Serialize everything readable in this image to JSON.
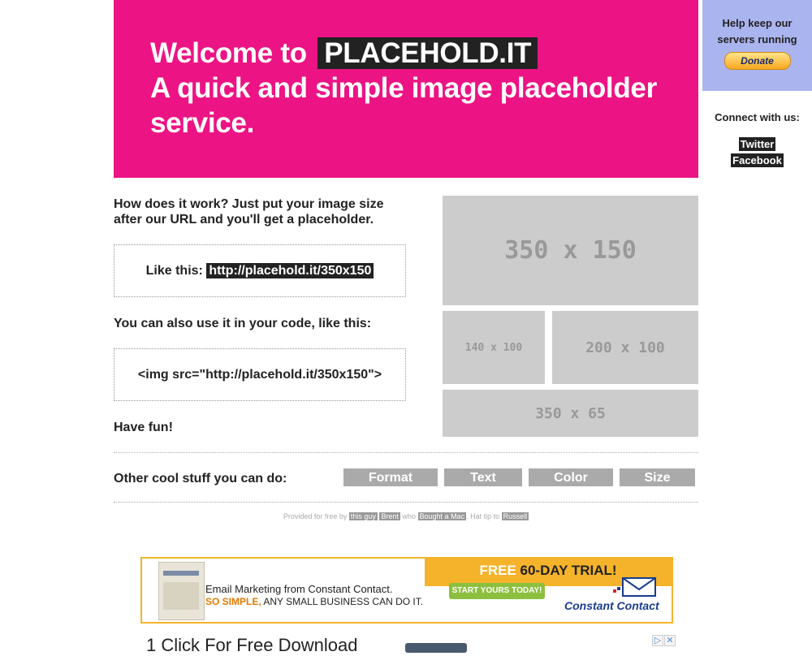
{
  "hero": {
    "welcome": "Welcome to",
    "brand": "PLACEHOLD.IT",
    "tagline_line1": "A quick and simple image placeholder",
    "tagline_line2": "service."
  },
  "sidebar": {
    "help_line1": "Help keep our",
    "help_line2": "servers running",
    "donate_label": "Donate",
    "connect_title": "Connect with us:",
    "twitter": "Twitter",
    "facebook": "Facebook"
  },
  "main": {
    "how_line1": "How does it work? Just put your image size",
    "how_line2": "after our URL and you'll get a placeholder.",
    "like_this": "Like this:",
    "example_url": "http://placehold.it/350x150",
    "code_intro": "You can also use it in your code, like this:",
    "code_sample": "<img src=\"http://placehold.it/350x150\">",
    "have_fun": "Have fun!"
  },
  "placeholders": [
    {
      "label": "350 x 150"
    },
    {
      "label": "140 x 100"
    },
    {
      "label": "200 x 100"
    },
    {
      "label": "350 x 65"
    }
  ],
  "other": {
    "title": "Other cool stuff you can do:",
    "tabs": [
      "Format",
      "Text",
      "Color",
      "Size"
    ]
  },
  "credits": {
    "provided": "Provided for free by",
    "this_guy": "this guy",
    "brent": "Brent",
    "who": "who",
    "bought_mac": "Bought a Mac",
    "hat_tip": ". Hat tip to",
    "russell": "Russell"
  },
  "ad": {
    "free": "FREE",
    "trial": "60-DAY TRIAL!",
    "line1": "Email Marketing from Constant Contact.",
    "line2_bold": "SO SIMPLE,",
    "line2_rest": "ANY SMALL BUSINESS CAN DO IT.",
    "cta": "START YOURS TODAY!",
    "brand": "Constant Contact"
  },
  "ad2": {
    "text": "1 Click For Free Download"
  },
  "colors": {
    "hero_bg": "#ec1484",
    "sidebar_bg": "#aab4ee",
    "placeholder_bg": "#cccccc",
    "tab_bg": "#aaaaaa"
  }
}
